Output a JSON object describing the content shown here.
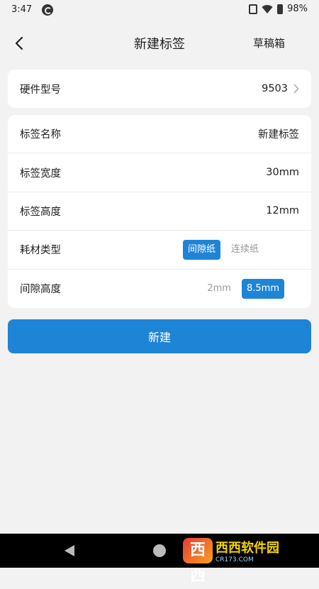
{
  "status_bar": {
    "time": "3:47",
    "battery_percent": "98%"
  },
  "header": {
    "title": "新建标签",
    "drafts_label": "草稿箱"
  },
  "hardware": {
    "label": "硬件型号",
    "value": "9503"
  },
  "form": {
    "name": {
      "label": "标签名称",
      "value": "新建标签"
    },
    "width": {
      "label": "标签宽度",
      "value": "30mm"
    },
    "height": {
      "label": "标签高度",
      "value": "12mm"
    },
    "consumable": {
      "label": "耗材类型",
      "options": [
        "间隙纸",
        "连续纸"
      ],
      "selected": "间隙纸"
    },
    "gap": {
      "label": "间隙高度",
      "options": [
        "2mm",
        "8.5mm"
      ],
      "selected": "8.5mm"
    }
  },
  "create_button_label": "新建",
  "watermark": {
    "logo_text": "西西",
    "main": "西西软件园",
    "sub": "CR173.COM"
  },
  "colors": {
    "accent": "#1e84d6",
    "background": "#f2f2f2"
  }
}
